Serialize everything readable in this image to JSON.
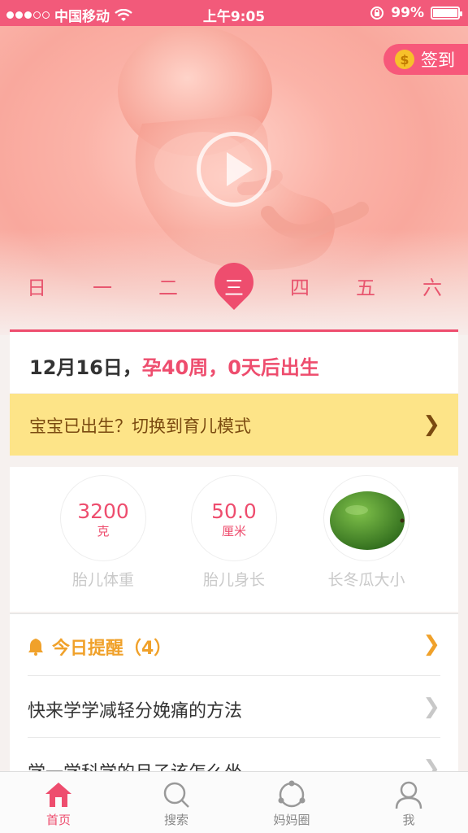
{
  "status_bar": {
    "carrier": "中国移动",
    "time": "上午9:05",
    "battery": "99%"
  },
  "hero": {
    "signin_label": "签到",
    "coin_symbol": "$",
    "weekdays": [
      "日",
      "一",
      "二",
      "三",
      "四",
      "五",
      "六"
    ],
    "selected_weekday": "三"
  },
  "date_card": {
    "date": "12月16日，",
    "pregnancy": "孕40周，0天后出生"
  },
  "mode_switch": {
    "label": "宝宝已出生？切换到育儿模式"
  },
  "stats": [
    {
      "value": "3200",
      "unit": "克",
      "label": "胎儿体重"
    },
    {
      "value": "50.0",
      "unit": "厘米",
      "label": "胎儿身长"
    },
    {
      "label": "长冬瓜大小"
    }
  ],
  "reminders": {
    "title": "今日提醒（4）",
    "items": [
      "快来学学减轻分娩痛的方法",
      "学一学科学的月子该怎么坐"
    ]
  },
  "tabbar": [
    {
      "label": "首页",
      "icon": "home-icon",
      "active": true
    },
    {
      "label": "搜索",
      "icon": "search-icon"
    },
    {
      "label": "妈妈圈",
      "icon": "circle-icon"
    },
    {
      "label": "我",
      "icon": "user-icon"
    }
  ],
  "colors": {
    "accent": "#ee4d6e",
    "status_bar": "#f25a7a",
    "mode_bar": "#fde488",
    "reminder": "#f0a12a"
  }
}
